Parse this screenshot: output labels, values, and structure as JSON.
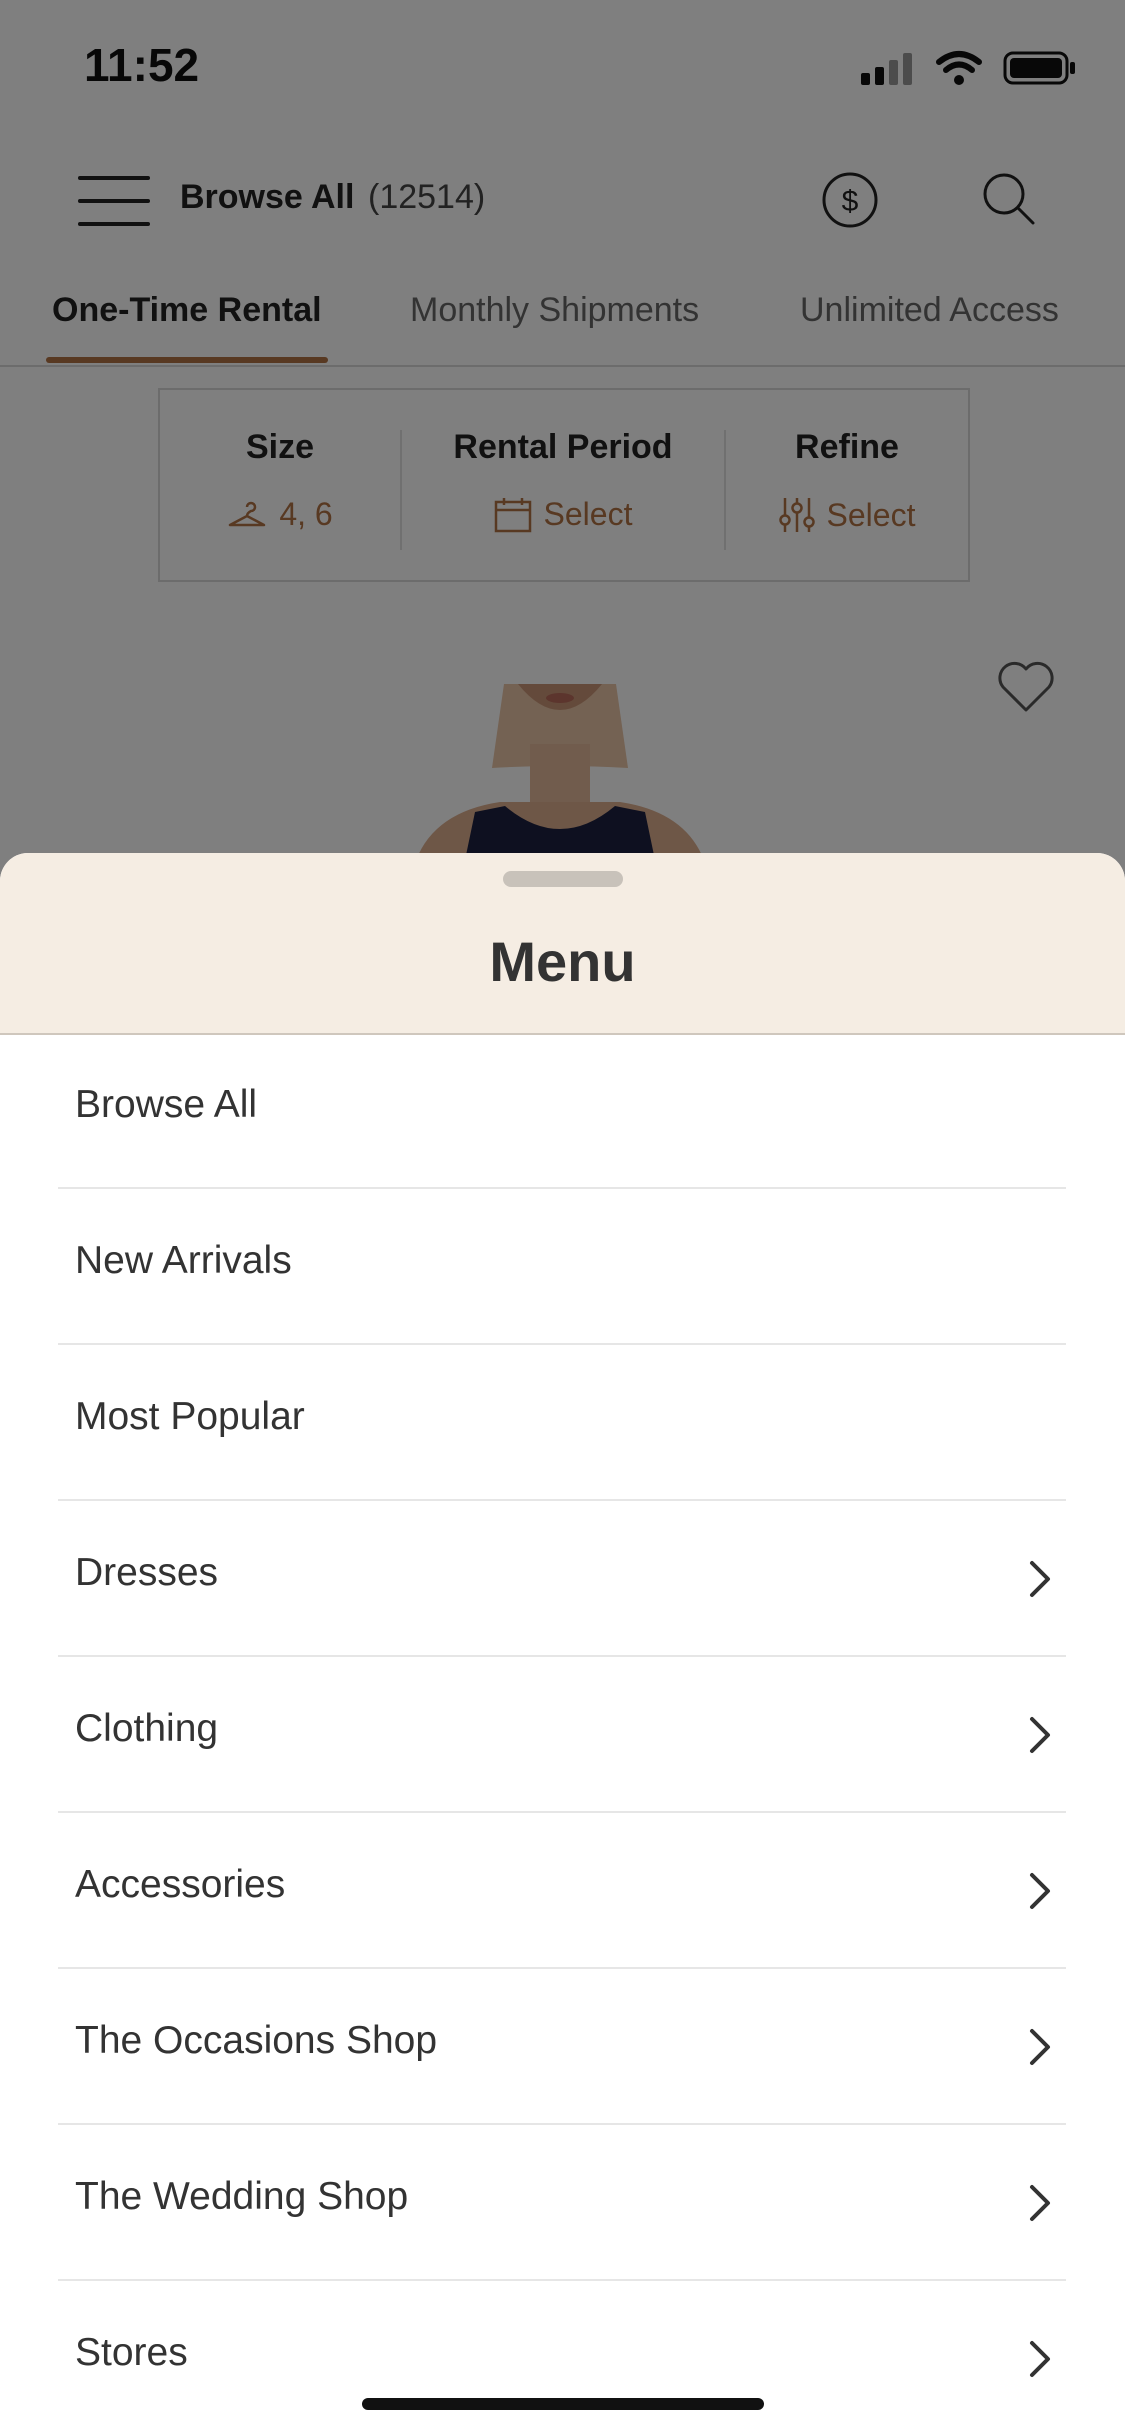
{
  "status_bar": {
    "time": "11:52"
  },
  "header": {
    "title": "Browse All",
    "count": "(12514)"
  },
  "tabs": [
    {
      "label": "One-Time Rental",
      "active": true
    },
    {
      "label": "Monthly Shipments",
      "active": false
    },
    {
      "label": "Unlimited Access",
      "active": false
    }
  ],
  "filters": {
    "size": {
      "label": "Size",
      "value": "4, 6"
    },
    "rental_period": {
      "label": "Rental Period",
      "value": "Select"
    },
    "refine": {
      "label": "Refine",
      "value": "Select"
    }
  },
  "menu": {
    "title": "Menu",
    "items": [
      {
        "label": "Browse All",
        "has_chevron": false
      },
      {
        "label": "New Arrivals",
        "has_chevron": false
      },
      {
        "label": "Most Popular",
        "has_chevron": false
      },
      {
        "label": "Dresses",
        "has_chevron": true
      },
      {
        "label": "Clothing",
        "has_chevron": true
      },
      {
        "label": "Accessories",
        "has_chevron": true
      },
      {
        "label": "The Occasions Shop",
        "has_chevron": true
      },
      {
        "label": "The Wedding Shop",
        "has_chevron": true
      },
      {
        "label": "Stores",
        "has_chevron": true
      }
    ]
  },
  "colors": {
    "accent": "#b07245",
    "sheet_header_bg": "#f5ede3",
    "overlay": "rgba(0,0,0,0.5)"
  },
  "icons": [
    "hamburger-icon",
    "dollar-icon",
    "search-icon",
    "hanger-icon",
    "calendar-icon",
    "sliders-icon",
    "heart-icon",
    "chevron-right-icon"
  ]
}
